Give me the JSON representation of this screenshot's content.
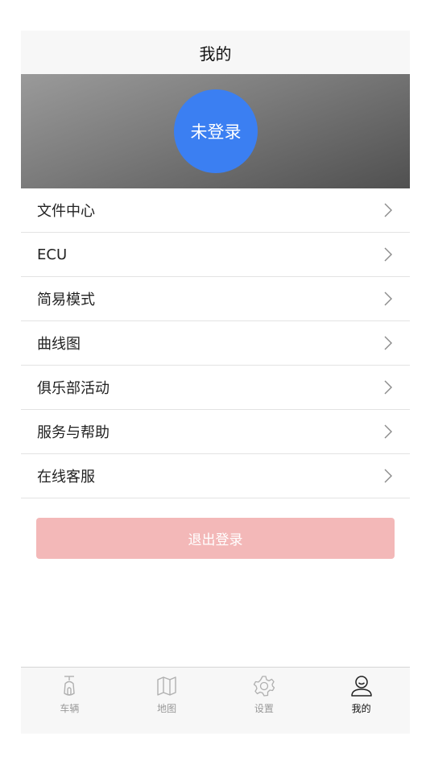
{
  "header": {
    "title": "我的"
  },
  "profile": {
    "login_button": "未登录"
  },
  "menu": {
    "items": [
      {
        "label": "文件中心"
      },
      {
        "label": "ECU"
      },
      {
        "label": "简易模式"
      },
      {
        "label": "曲线图"
      },
      {
        "label": "俱乐部活动"
      },
      {
        "label": "服务与帮助"
      },
      {
        "label": "在线客服"
      }
    ]
  },
  "logout": {
    "label": "退出登录"
  },
  "tabbar": {
    "tabs": [
      {
        "label": "车辆",
        "icon": "scooter-icon"
      },
      {
        "label": "地图",
        "icon": "map-icon"
      },
      {
        "label": "设置",
        "icon": "gear-icon"
      },
      {
        "label": "我的",
        "icon": "user-icon"
      }
    ],
    "active_index": 3
  },
  "colors": {
    "accent": "#3b7ff2",
    "logout_bg": "#f3b8b8"
  }
}
